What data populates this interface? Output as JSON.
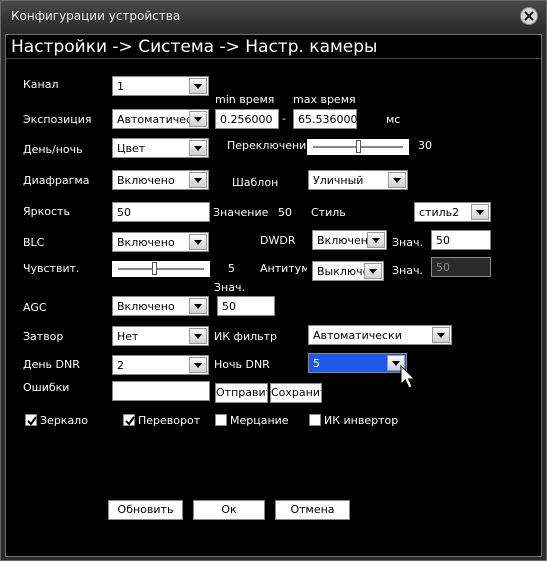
{
  "window": {
    "title": "Конфигурации устройства"
  },
  "header": {
    "title": "Настройки -> Система -> Настр. камеры"
  },
  "labels": {
    "channel": "Канал",
    "exposure": "Экспозиция",
    "min_time": "min время",
    "max_time": "max время",
    "dash": "-",
    "ms": "мс",
    "day_night": "День/ночь",
    "switching": "Переключение",
    "iris": "Диафрагма",
    "template": "Шаблон",
    "brightness": "Яркость",
    "value": "Значение",
    "style": "Стиль",
    "blc": "BLC",
    "dwdr": "DWDR",
    "znach": "Знач.",
    "sensitivity": "Чувствит.",
    "antitum": "Антитума",
    "znach2": "Знач.",
    "znach3": "Знач.",
    "agc": "AGC",
    "shutter": "Затвор",
    "ir_filter": "ИК фильтр",
    "day_dnr": "День DNR",
    "night_dnr": "Ночь DNR",
    "errors": "Ошибки"
  },
  "fields": {
    "channel": "1",
    "exposure": "Автоматически",
    "min_time": "0.256000",
    "max_time": "65.536000",
    "day_night": "Цвет",
    "switching_value": "30",
    "iris": "Включено",
    "template": "Уличный",
    "brightness": "50",
    "brightness_value": "50",
    "style": "стиль2",
    "blc": "Включено",
    "dwdr": "Включено",
    "dwdr_value": "50",
    "sensitivity_value": "5",
    "antitum": "Выключено",
    "antitum_value": "50",
    "agc": "Включено",
    "agc_value": "50",
    "shutter": "Нет",
    "ir_filter": "Автоматически",
    "day_dnr": "2",
    "night_dnr": "5",
    "errors": ""
  },
  "sliders": {
    "switching_level": 0.5,
    "sensitivity_level": 0.42
  },
  "buttons": {
    "send": "Отправить",
    "save": "Сохранить",
    "refresh": "Обновить",
    "ok": "Ок",
    "cancel": "Отмена"
  },
  "checkboxes": [
    {
      "label": "Зеркало",
      "checked": true
    },
    {
      "label": "Переворот",
      "checked": true
    },
    {
      "label": "Мерцание",
      "checked": false
    },
    {
      "label": "ИК инвертор",
      "checked": false
    }
  ]
}
